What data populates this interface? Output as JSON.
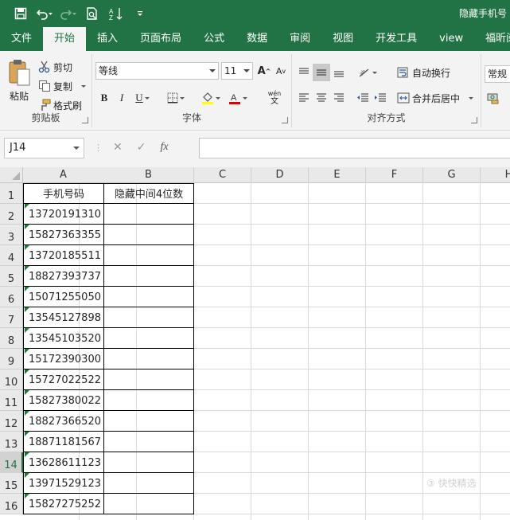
{
  "title_bar": {
    "document_title": "隐藏手机号"
  },
  "tabs": [
    {
      "label": "文件"
    },
    {
      "label": "开始"
    },
    {
      "label": "插入"
    },
    {
      "label": "页面布局"
    },
    {
      "label": "公式"
    },
    {
      "label": "数据"
    },
    {
      "label": "审阅"
    },
    {
      "label": "视图"
    },
    {
      "label": "开发工具"
    },
    {
      "label": "view"
    },
    {
      "label": "福昕阅读"
    }
  ],
  "active_tab": "开始",
  "ribbon": {
    "clipboard": {
      "label": "剪贴板",
      "paste": "粘贴",
      "cut": "剪切",
      "copy": "复制",
      "format_painter": "格式刷"
    },
    "font": {
      "label": "字体",
      "font_name": "等线",
      "font_size": "11",
      "bold": "B",
      "italic": "I",
      "underline": "U",
      "wen": "wén",
      "wen_char": "文",
      "grow": "A",
      "shrink": "A"
    },
    "alignment": {
      "label": "对齐方式",
      "wrap_text": "自动换行",
      "merge_center": "合并后居中"
    },
    "number": {
      "format": "常规"
    }
  },
  "formula_bar": {
    "name_box": "J14",
    "cancel": "✕",
    "enter": "✓",
    "fx": "fx",
    "formula": ""
  },
  "columns": [
    "A",
    "B",
    "C",
    "D",
    "E",
    "F",
    "G",
    "H"
  ],
  "rows": [
    "1",
    "2",
    "3",
    "4",
    "5",
    "6",
    "7",
    "8",
    "9",
    "10",
    "11",
    "12",
    "13",
    "14",
    "15",
    "16"
  ],
  "selected_row": "14",
  "header_cells": {
    "a1": "手机号码",
    "b1": "隐藏中间4位数"
  },
  "phone_numbers": [
    "13720191310",
    "15827363355",
    "13720185511",
    "18827393737",
    "15071255050",
    "13545127898",
    "13545103520",
    "15172390300",
    "15727022522",
    "15827380022",
    "18827366520",
    "18871181567",
    "13628611123",
    "13971529123",
    "15827275252"
  ],
  "watermark": "③ 快快精选"
}
